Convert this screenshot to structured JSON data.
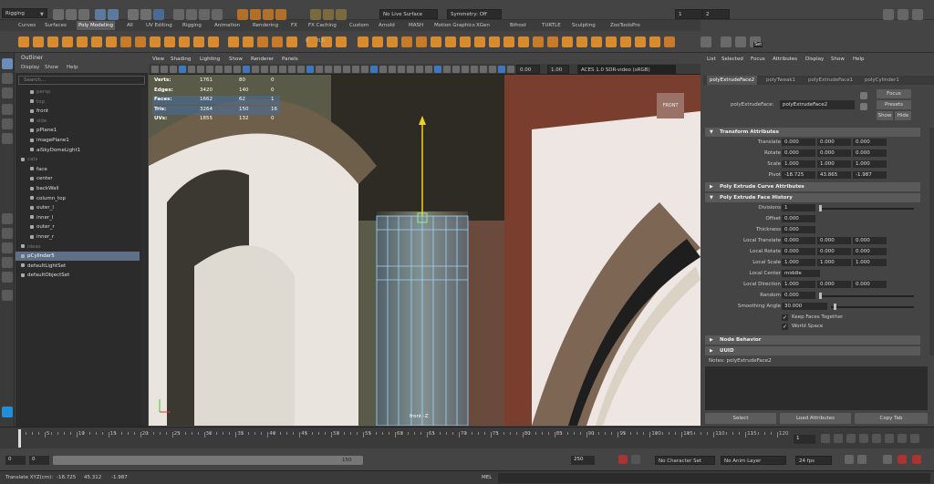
{
  "menubar": {
    "mode": "Rigging"
  },
  "statusline": {
    "live_surface": "No Live Surface",
    "symmetry": "Symmetry: Off",
    "field1": "1",
    "field2": "2"
  },
  "shelf_tabs": [
    "Curves",
    "Surfaces",
    "Poly Modeling",
    "All",
    "UV Editing",
    "Rigging",
    "Animation",
    "Rendering",
    "FX",
    "FX Caching",
    "Custom",
    "Arnold",
    "MASH",
    "Motion Graphics",
    "XGen",
    "Bifrost",
    "TURTLE",
    "Sculpting",
    "ZooToolsPro"
  ],
  "shelf_active": "Poly Modeling",
  "shelf_values": {
    "v1": "0",
    "v2": "0,0"
  },
  "shelf_set_label": "Set",
  "outliner": {
    "title": "Outliner",
    "menu": [
      "Display",
      "Show",
      "Help"
    ],
    "search_placeholder": "Search...",
    "items": [
      {
        "label": "persp",
        "indent": 1,
        "dim": true
      },
      {
        "label": "top",
        "indent": 1,
        "dim": true
      },
      {
        "label": "front",
        "indent": 1,
        "dim": false
      },
      {
        "label": "side",
        "indent": 1,
        "dim": true
      },
      {
        "label": "pPlane1",
        "indent": 1,
        "dim": false
      },
      {
        "label": "imagePlane1",
        "indent": 1,
        "dim": false
      },
      {
        "label": "aiSkyDomeLight1",
        "indent": 1,
        "dim": false
      },
      {
        "label": "cats",
        "indent": 0,
        "dim": true
      },
      {
        "label": "face",
        "indent": 1,
        "dim": false
      },
      {
        "label": "center",
        "indent": 1,
        "dim": false
      },
      {
        "label": "backWall",
        "indent": 1,
        "dim": false
      },
      {
        "label": "column_top",
        "indent": 1,
        "dim": false
      },
      {
        "label": "outer_l",
        "indent": 1,
        "dim": false
      },
      {
        "label": "inner_l",
        "indent": 1,
        "dim": false
      },
      {
        "label": "outer_r",
        "indent": 1,
        "dim": false
      },
      {
        "label": "inner_r",
        "indent": 1,
        "dim": false
      },
      {
        "label": "ideas",
        "indent": 0,
        "dim": true
      },
      {
        "label": "pCylinder5",
        "indent": 0,
        "dim": false,
        "selected": true
      },
      {
        "label": "defaultLightSet",
        "indent": 0,
        "dim": false
      },
      {
        "label": "defaultObjectSet",
        "indent": 0,
        "dim": false
      }
    ]
  },
  "viewport": {
    "menu": [
      "View",
      "Shading",
      "Lighting",
      "Show",
      "Renderer",
      "Panels"
    ],
    "exposure": "0.00",
    "gamma": "1.00",
    "colorspace": "ACES 1.0 SDR-video (sRGB)",
    "hud": [
      {
        "label": "Verts:",
        "a": "1761",
        "b": "80",
        "c": "0"
      },
      {
        "label": "Edges:",
        "a": "3420",
        "b": "140",
        "c": "0"
      },
      {
        "label": "Faces:",
        "a": "1662",
        "b": "62",
        "c": "1"
      },
      {
        "label": "Tris:",
        "a": "3264",
        "b": "150",
        "c": "16"
      },
      {
        "label": "UVs:",
        "a": "1855",
        "b": "132",
        "c": "0"
      }
    ],
    "cube_label": "FRONT",
    "camera_label": "front -Z"
  },
  "attr": {
    "menu": [
      "List",
      "Selected",
      "Focus",
      "Attributes",
      "Display",
      "Show",
      "Help"
    ],
    "tabs": [
      "polyExtrudeFace2",
      "polyTweak1",
      "polyExtrudeFace1",
      "polyCylinder1"
    ],
    "node_label": "polyExtrudeFace:",
    "node_name": "polyExtrudeFace2",
    "focus": "Focus",
    "presets": "Presets",
    "show": "Show",
    "hide": "Hide",
    "sections": {
      "transform": "Transform Attributes",
      "curve": "Poly Extrude Curve Attributes",
      "history": "Poly Extrude Face History",
      "node": "Node Behavior",
      "uuid": "UUID"
    },
    "transform": [
      {
        "label": "Translate",
        "v": [
          "0.000",
          "0.000",
          "0.000"
        ]
      },
      {
        "label": "Rotate",
        "v": [
          "0.000",
          "0.000",
          "0.000"
        ]
      },
      {
        "label": "Scale",
        "v": [
          "1.000",
          "1.000",
          "1.000"
        ]
      },
      {
        "label": "Pivot",
        "v": [
          "-18.725",
          "43.865",
          "-1.987"
        ]
      }
    ],
    "history_single": [
      {
        "label": "Divisions",
        "v": "1"
      },
      {
        "label": "Offset",
        "v": "0.000"
      },
      {
        "label": "Thickness",
        "v": "0.000"
      }
    ],
    "history_triple": [
      {
        "label": "Local Translate",
        "v": [
          "0.000",
          "0.000",
          "0.000"
        ]
      },
      {
        "label": "Local Rotate",
        "v": [
          "0.000",
          "0.000",
          "0.000"
        ]
      },
      {
        "label": "Local Scale",
        "v": [
          "1.000",
          "1.000",
          "1.000"
        ]
      }
    ],
    "local_center": {
      "label": "Local Center",
      "v": "middle"
    },
    "local_direction": {
      "label": "Local Direction",
      "v": [
        "1.000",
        "0.000",
        "0.000"
      ]
    },
    "random": {
      "label": "Random",
      "v": "0.000"
    },
    "smoothing": {
      "label": "Smoothing Angle",
      "v": "30.000"
    },
    "checks": [
      "Keep Faces Together",
      "World Space"
    ],
    "notes": "Notes: polyExtrudeFace2",
    "bottom_buttons": [
      "Select",
      "Load Attributes",
      "Copy Tab"
    ]
  },
  "timeline": {
    "ticks": [
      "5",
      "10",
      "15",
      "20",
      "25",
      "30",
      "35",
      "40",
      "45",
      "50",
      "55",
      "60",
      "65",
      "70",
      "75",
      "80",
      "85",
      "90",
      "95",
      "100",
      "105",
      "110",
      "115",
      "120"
    ],
    "current": "1"
  },
  "range": {
    "start": "0",
    "inner_start": "0",
    "inner_end": "150",
    "end": "250",
    "character": "No Character Set",
    "anim_layer": "No Anim Layer",
    "fps": "24 fps"
  },
  "cmdline": {
    "readout": "Translate XYZ(cm):",
    "x": "-18.725",
    "y": "45.312",
    "z": "-1.987",
    "lang": "MEL"
  }
}
